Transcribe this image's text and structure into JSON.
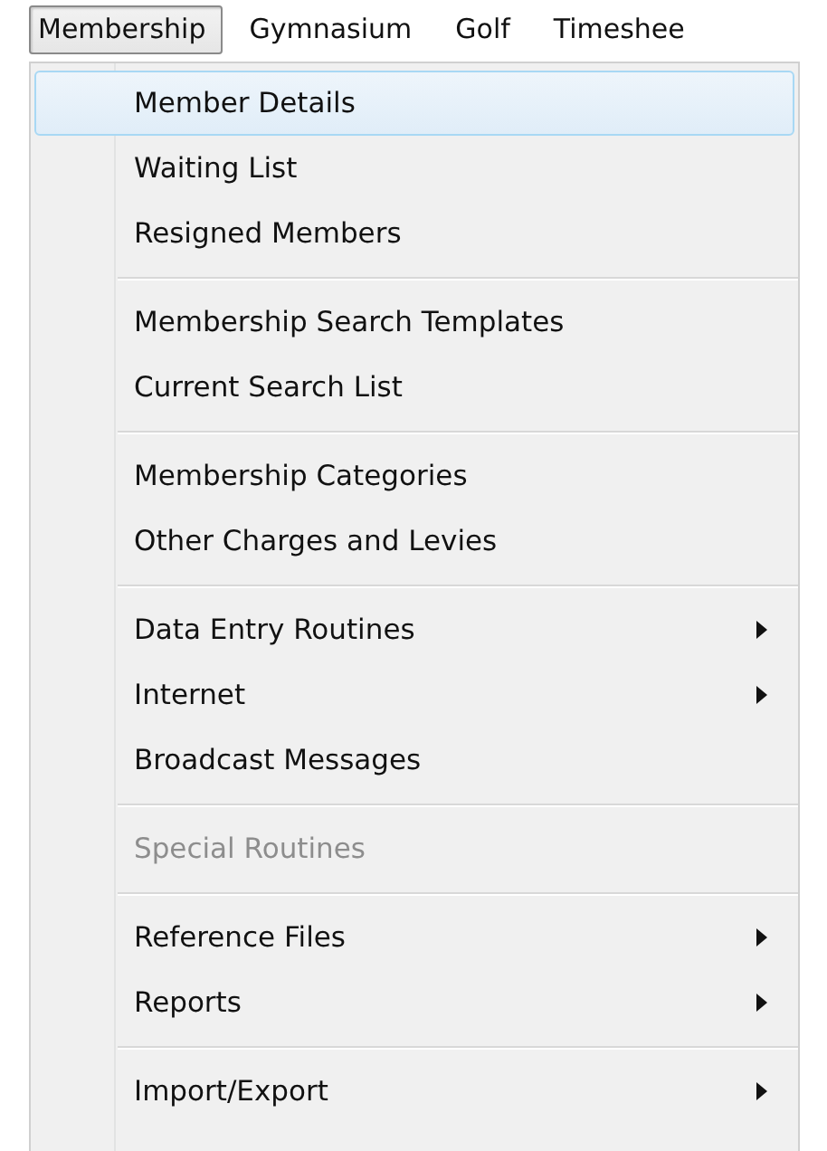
{
  "menubar": [
    {
      "label": "Membership",
      "selected": true
    },
    {
      "label": "Gymnasium",
      "selected": false
    },
    {
      "label": "Golf",
      "selected": false
    },
    {
      "label": "Timeshee",
      "selected": false
    }
  ],
  "menu": {
    "groups": [
      {
        "items": [
          {
            "label": "Member Details",
            "selected": true,
            "disabled": false,
            "submenu": false
          },
          {
            "label": "Waiting List",
            "selected": false,
            "disabled": false,
            "submenu": false
          },
          {
            "label": "Resigned Members",
            "selected": false,
            "disabled": false,
            "submenu": false
          }
        ]
      },
      {
        "items": [
          {
            "label": "Membership Search Templates",
            "selected": false,
            "disabled": false,
            "submenu": false
          },
          {
            "label": "Current Search List",
            "selected": false,
            "disabled": false,
            "submenu": false
          }
        ]
      },
      {
        "items": [
          {
            "label": "Membership Categories",
            "selected": false,
            "disabled": false,
            "submenu": false
          },
          {
            "label": "Other Charges and Levies",
            "selected": false,
            "disabled": false,
            "submenu": false
          }
        ]
      },
      {
        "items": [
          {
            "label": "Data Entry Routines",
            "selected": false,
            "disabled": false,
            "submenu": true
          },
          {
            "label": "Internet",
            "selected": false,
            "disabled": false,
            "submenu": true
          },
          {
            "label": "Broadcast Messages",
            "selected": false,
            "disabled": false,
            "submenu": false
          }
        ]
      },
      {
        "items": [
          {
            "label": "Special Routines",
            "selected": false,
            "disabled": true,
            "submenu": false
          }
        ]
      },
      {
        "items": [
          {
            "label": "Reference Files",
            "selected": false,
            "disabled": false,
            "submenu": true
          },
          {
            "label": "Reports",
            "selected": false,
            "disabled": false,
            "submenu": true
          }
        ]
      },
      {
        "items": [
          {
            "label": "Import/Export",
            "selected": false,
            "disabled": false,
            "submenu": true
          }
        ]
      }
    ]
  }
}
